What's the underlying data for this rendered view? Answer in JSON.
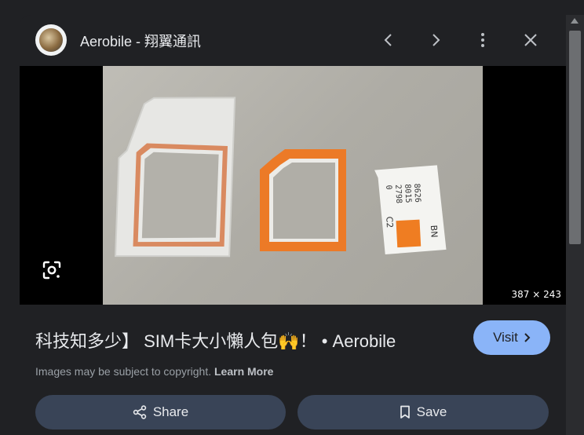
{
  "header": {
    "site_title": "Aerobile - 翔翼通訊",
    "icons": {
      "prev": "chevron-left-icon",
      "next": "chevron-right-icon",
      "more": "more-vert-icon",
      "close": "close-icon"
    }
  },
  "image": {
    "dimensions": "387 × 243",
    "lens_icon": "google-lens-icon"
  },
  "caption": {
    "title": "科技知多少】 SIM卡大小懶人包🙌！ • Aerobile"
  },
  "visit": {
    "label": "Visit"
  },
  "copyright": {
    "text": "Images may be subject to copyright. ",
    "link": "Learn More"
  },
  "actions": {
    "share_label": "Share",
    "save_label": "Save"
  },
  "colors": {
    "background": "#202124",
    "visit_bg": "#8ab4f8",
    "action_bg": "#394457"
  }
}
